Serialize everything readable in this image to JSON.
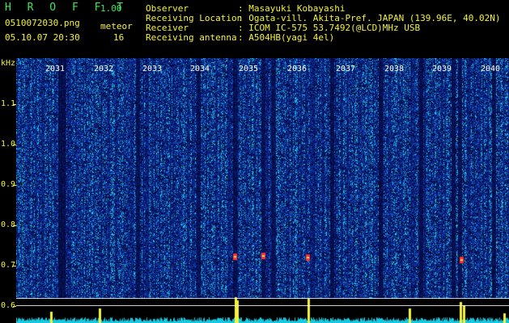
{
  "header": {
    "app_title": "H R O F F T",
    "version": "1.00",
    "filename": "0510072030.png",
    "datetime": "05.10.07 20:30",
    "meteor_label": "meteor",
    "meteor_count": "16",
    "info": [
      {
        "label": "Observer",
        "value": ": Masayuki Kobayashi"
      },
      {
        "label": "Receiving Location",
        "value": ": Ogata-vill. Akita-Pref. JAPAN (139.96E, 40.02N)"
      },
      {
        "label": "Receiver",
        "value": ": ICOM IC-575 53.7492(@LCD)MHz USB"
      },
      {
        "label": "Receiving antenna",
        "value": ": A504HB(yagi 4el)"
      }
    ]
  },
  "axis": {
    "unit": "kHz",
    "freq_labels": [
      "1.1",
      "1.0",
      "0.9",
      "0.8",
      "0.7",
      "0.6"
    ],
    "time_labels": [
      "2031",
      "2032",
      "2033",
      "2034",
      "2035",
      "2036",
      "2037",
      "2038",
      "2039",
      "2040"
    ]
  },
  "colors": {
    "text_green": "#3ee65a",
    "text_yellow": "#f4f23a",
    "background": "#000000",
    "spectrum_low": "#0a1a6e",
    "spectrum_high": "#00e5ff",
    "signal": "#ff3030",
    "level": "#f4f23a"
  }
}
